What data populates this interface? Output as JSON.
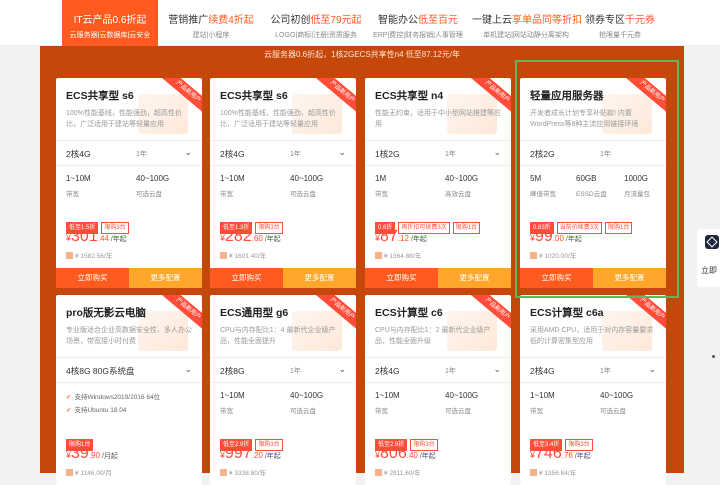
{
  "nav": [
    {
      "title": "IT云产品0.6折起",
      "sub": "云服务器|云数据库|云安全"
    },
    {
      "title_plain": "营销推广",
      "title_hl": "续费4折起",
      "sub": "建站|小程序"
    },
    {
      "title_plain": "公司初创",
      "title_hl": "低至79元起",
      "sub": "LOGO|商标|注册|资质服务"
    },
    {
      "title_plain": "智能办公",
      "title_hl": "低至百元",
      "sub": "ERP|费控|财务报销|人事管理"
    },
    {
      "title_plain": "一键上云",
      "title_hl": "享单品同等折扣",
      "sub": "单机建站|网站动静分离架构"
    },
    {
      "title_plain": "领券专区",
      "title_hl": "千元券",
      "sub": "抢限量千元券"
    }
  ],
  "banner": "云服务器0.6折起，1核2GECS共享性n4 低至87.12元/年",
  "ribbon": "产品新用户",
  "cards": [
    {
      "title": "ECS共享型 s6",
      "desc": "100%性能基线，性能强劲，超高性价比，广泛适用于建站等轻量应用",
      "config": "2核4G",
      "period": "1年",
      "specs": [
        {
          "v": "1~10M",
          "l": "带宽"
        },
        {
          "v": "40~100G",
          "l": "可选云盘"
        }
      ],
      "tags": [
        {
          "t": "低至1.5折",
          "solid": true
        },
        {
          "t": "限购3台",
          "solid": false
        }
      ],
      "cur": "¥",
      "int": "301",
      "dec": ".44",
      "unit": "/年起",
      "orig": "¥ 1582.56/年",
      "buy": "立即购买",
      "more": "更多配置"
    },
    {
      "title": "ECS共享型 s6",
      "desc": "100%性能基线，性能强劲，超高性价比，广泛适用于建站等轻量应用",
      "config": "2核4G",
      "period": "1年",
      "specs": [
        {
          "v": "1~10M",
          "l": "带宽"
        },
        {
          "v": "40~100G",
          "l": "可选云盘"
        }
      ],
      "tags": [
        {
          "t": "低至1.3折",
          "solid": true
        },
        {
          "t": "限购3台",
          "solid": false
        }
      ],
      "cur": "¥",
      "int": "282",
      "dec": ".60",
      "unit": "/年起",
      "orig": "¥ 1601.40/年",
      "buy": "立即购买",
      "more": "更多配置"
    },
    {
      "title": "ECS共享型 n4",
      "desc": "性能无约束，适用于中小型网站搭建等应用",
      "config": "1核2G",
      "period": "1年",
      "specs": [
        {
          "v": "1M",
          "l": "带宽"
        },
        {
          "v": "40~100G",
          "l": "高效云盘"
        }
      ],
      "tags": [
        {
          "t": "0.6折",
          "solid": true
        },
        {
          "t": "再折扣可续费3次",
          "solid": false
        },
        {
          "t": "限购1台",
          "solid": false
        }
      ],
      "cur": "¥",
      "int": "87",
      "dec": ".12",
      "unit": "/年起",
      "orig": "¥ 1364.88/年",
      "buy": "立即购买",
      "more": "更多配置"
    },
    {
      "title": "轻量应用服务器",
      "desc": "开发者成长计划专享补贴款! 内置WordPress等8种主流应用链接环境",
      "config": "2核2G",
      "period": "1年",
      "specs3": [
        {
          "v": "5M",
          "l": "峰值带宽"
        },
        {
          "v": "60GB",
          "l": "ESSD云盘"
        },
        {
          "v": "1000G",
          "l": "月流量包"
        }
      ],
      "tags": [
        {
          "t": "0.83折",
          "solid": true
        },
        {
          "t": "当前价续费3次",
          "solid": false
        },
        {
          "t": "限购1台",
          "solid": false
        }
      ],
      "cur": "¥",
      "int": "99",
      "dec": ".00",
      "unit": "/年起",
      "orig": "¥ 1020.00/年",
      "buy": "立即购买",
      "more": "更多配置"
    },
    {
      "title": "pro版无影云电脑",
      "desc": "专业版适合企业高数据安全性、多人办公场景，带宽接小时付费",
      "config": "4核8G 80G系统盘",
      "feats": [
        "支持Windows2019/2016 64位",
        "支持Ubuntu 18.04"
      ],
      "tags": [
        {
          "t": "限购1台",
          "solid": true
        }
      ],
      "cur": "¥",
      "int": "39",
      "dec": ".90",
      "unit": "/月起",
      "orig": "¥ 1146.00/月"
    },
    {
      "title": "ECS通用型 g6",
      "desc": "CPU与内存配比1：4 最新代企业级产品，性能全面提升",
      "config": "2核8G",
      "period": "1年",
      "specs": [
        {
          "v": "1~10M",
          "l": "带宽"
        },
        {
          "v": "40~100G",
          "l": "可选云盘"
        }
      ],
      "tags": [
        {
          "t": "低至2.9折",
          "solid": true
        },
        {
          "t": "限购3台",
          "solid": false
        }
      ],
      "cur": "¥",
      "int": "997",
      "dec": ".20",
      "unit": "/年起",
      "orig": "¥ 3338.80/年"
    },
    {
      "title": "ECS计算型 c6",
      "desc": "CPU与内存配比1：2 最新代企业级产品，性能全面升级",
      "config": "2核4G",
      "period": "1年",
      "specs": [
        {
          "v": "1~10M",
          "l": "带宽"
        },
        {
          "v": "40~100G",
          "l": "可选云盘"
        }
      ],
      "tags": [
        {
          "t": "低至2.9折",
          "solid": true
        },
        {
          "t": "限购3台",
          "solid": false
        }
      ],
      "cur": "¥",
      "int": "806",
      "dec": ".40",
      "unit": "/年起",
      "orig": "¥ 2811.60/年"
    },
    {
      "title": "ECS计算型 c6a",
      "desc": "采用AMD CPU，适用于对内存容量要求低的计算密集型应用",
      "config": "2核4G",
      "period": "1年",
      "specs": [
        {
          "v": "1~10M",
          "l": "带宽"
        },
        {
          "v": "40~100G",
          "l": "可选云盘"
        }
      ],
      "tags": [
        {
          "t": "低至3.4折",
          "solid": true
        },
        {
          "t": "限购3台",
          "solid": false
        }
      ],
      "cur": "¥",
      "int": "746",
      "dec": ".76",
      "unit": "/年起",
      "orig": "¥ 1356.84/年"
    }
  ],
  "side": {
    "label": "立即"
  }
}
